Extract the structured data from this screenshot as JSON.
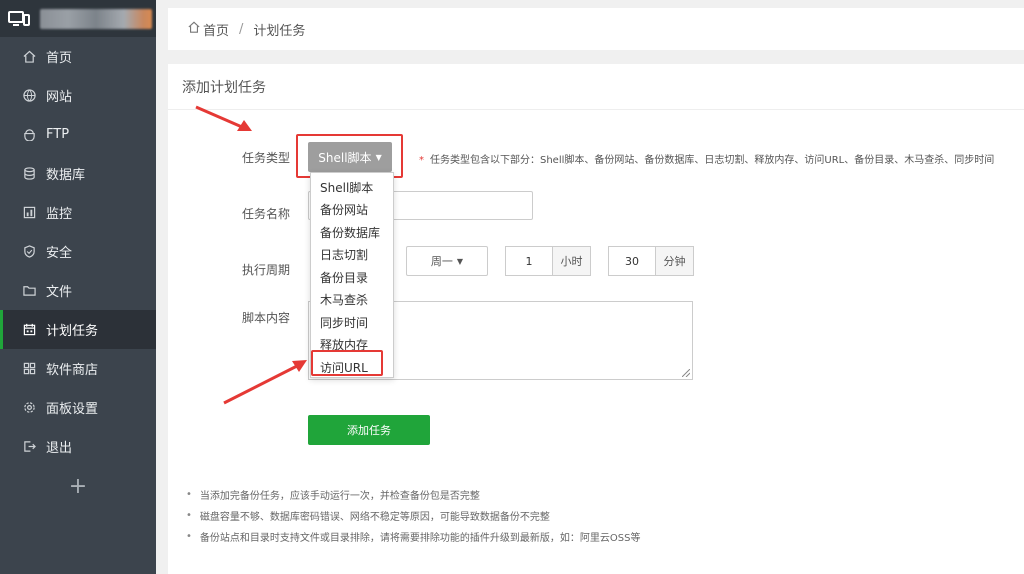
{
  "sidebar": {
    "items": [
      {
        "label": "首页",
        "icon": "home-icon"
      },
      {
        "label": "网站",
        "icon": "globe-icon"
      },
      {
        "label": "FTP",
        "icon": "ftp-icon"
      },
      {
        "label": "数据库",
        "icon": "database-icon"
      },
      {
        "label": "监控",
        "icon": "monitor-icon"
      },
      {
        "label": "安全",
        "icon": "shield-icon"
      },
      {
        "label": "文件",
        "icon": "folder-icon"
      },
      {
        "label": "计划任务",
        "icon": "calendar-icon"
      },
      {
        "label": "软件商店",
        "icon": "grid-icon"
      },
      {
        "label": "面板设置",
        "icon": "gear-icon"
      },
      {
        "label": "退出",
        "icon": "logout-icon"
      }
    ],
    "active_index": 7,
    "add_label": "+"
  },
  "breadcrumb": {
    "home": "首页",
    "separator": "/",
    "current": "计划任务"
  },
  "card": {
    "title": "添加计划任务"
  },
  "form": {
    "type_label": "任务类型",
    "type_value": "Shell脚本",
    "type_hint_star": "*",
    "type_hint": "任务类型包含以下部分：Shell脚本、备份网站、备份数据库、日志切割、释放内存、访问URL、备份目录、木马查杀、同步时间",
    "name_label": "任务名称",
    "period_label": "执行周期",
    "period_week": "周一",
    "period_hour_value": "1",
    "period_hour_unit": "小时",
    "period_minute_value": "30",
    "period_minute_unit": "分钟",
    "script_label": "脚本内容",
    "submit_label": "添加任务"
  },
  "dropdown": {
    "options": [
      "Shell脚本",
      "备份网站",
      "备份数据库",
      "日志切割",
      "备份目录",
      "木马查杀",
      "同步时间",
      "释放内存",
      "访问URL"
    ],
    "highlighted": "访问URL"
  },
  "notes": [
    "当添加完备份任务，应该手动运行一次，并检查备份包是否完整",
    "磁盘容量不够、数据库密码错误、网络不稳定等原因，可能导致数据备份不完整",
    "备份站点和目录时支持文件或目录排除，请将需要排除功能的插件升级到最新版，如：阿里云OSS等"
  ],
  "colors": {
    "accent": "#20a53a",
    "highlight": "#e53935",
    "sidebar": "#3c444d"
  }
}
